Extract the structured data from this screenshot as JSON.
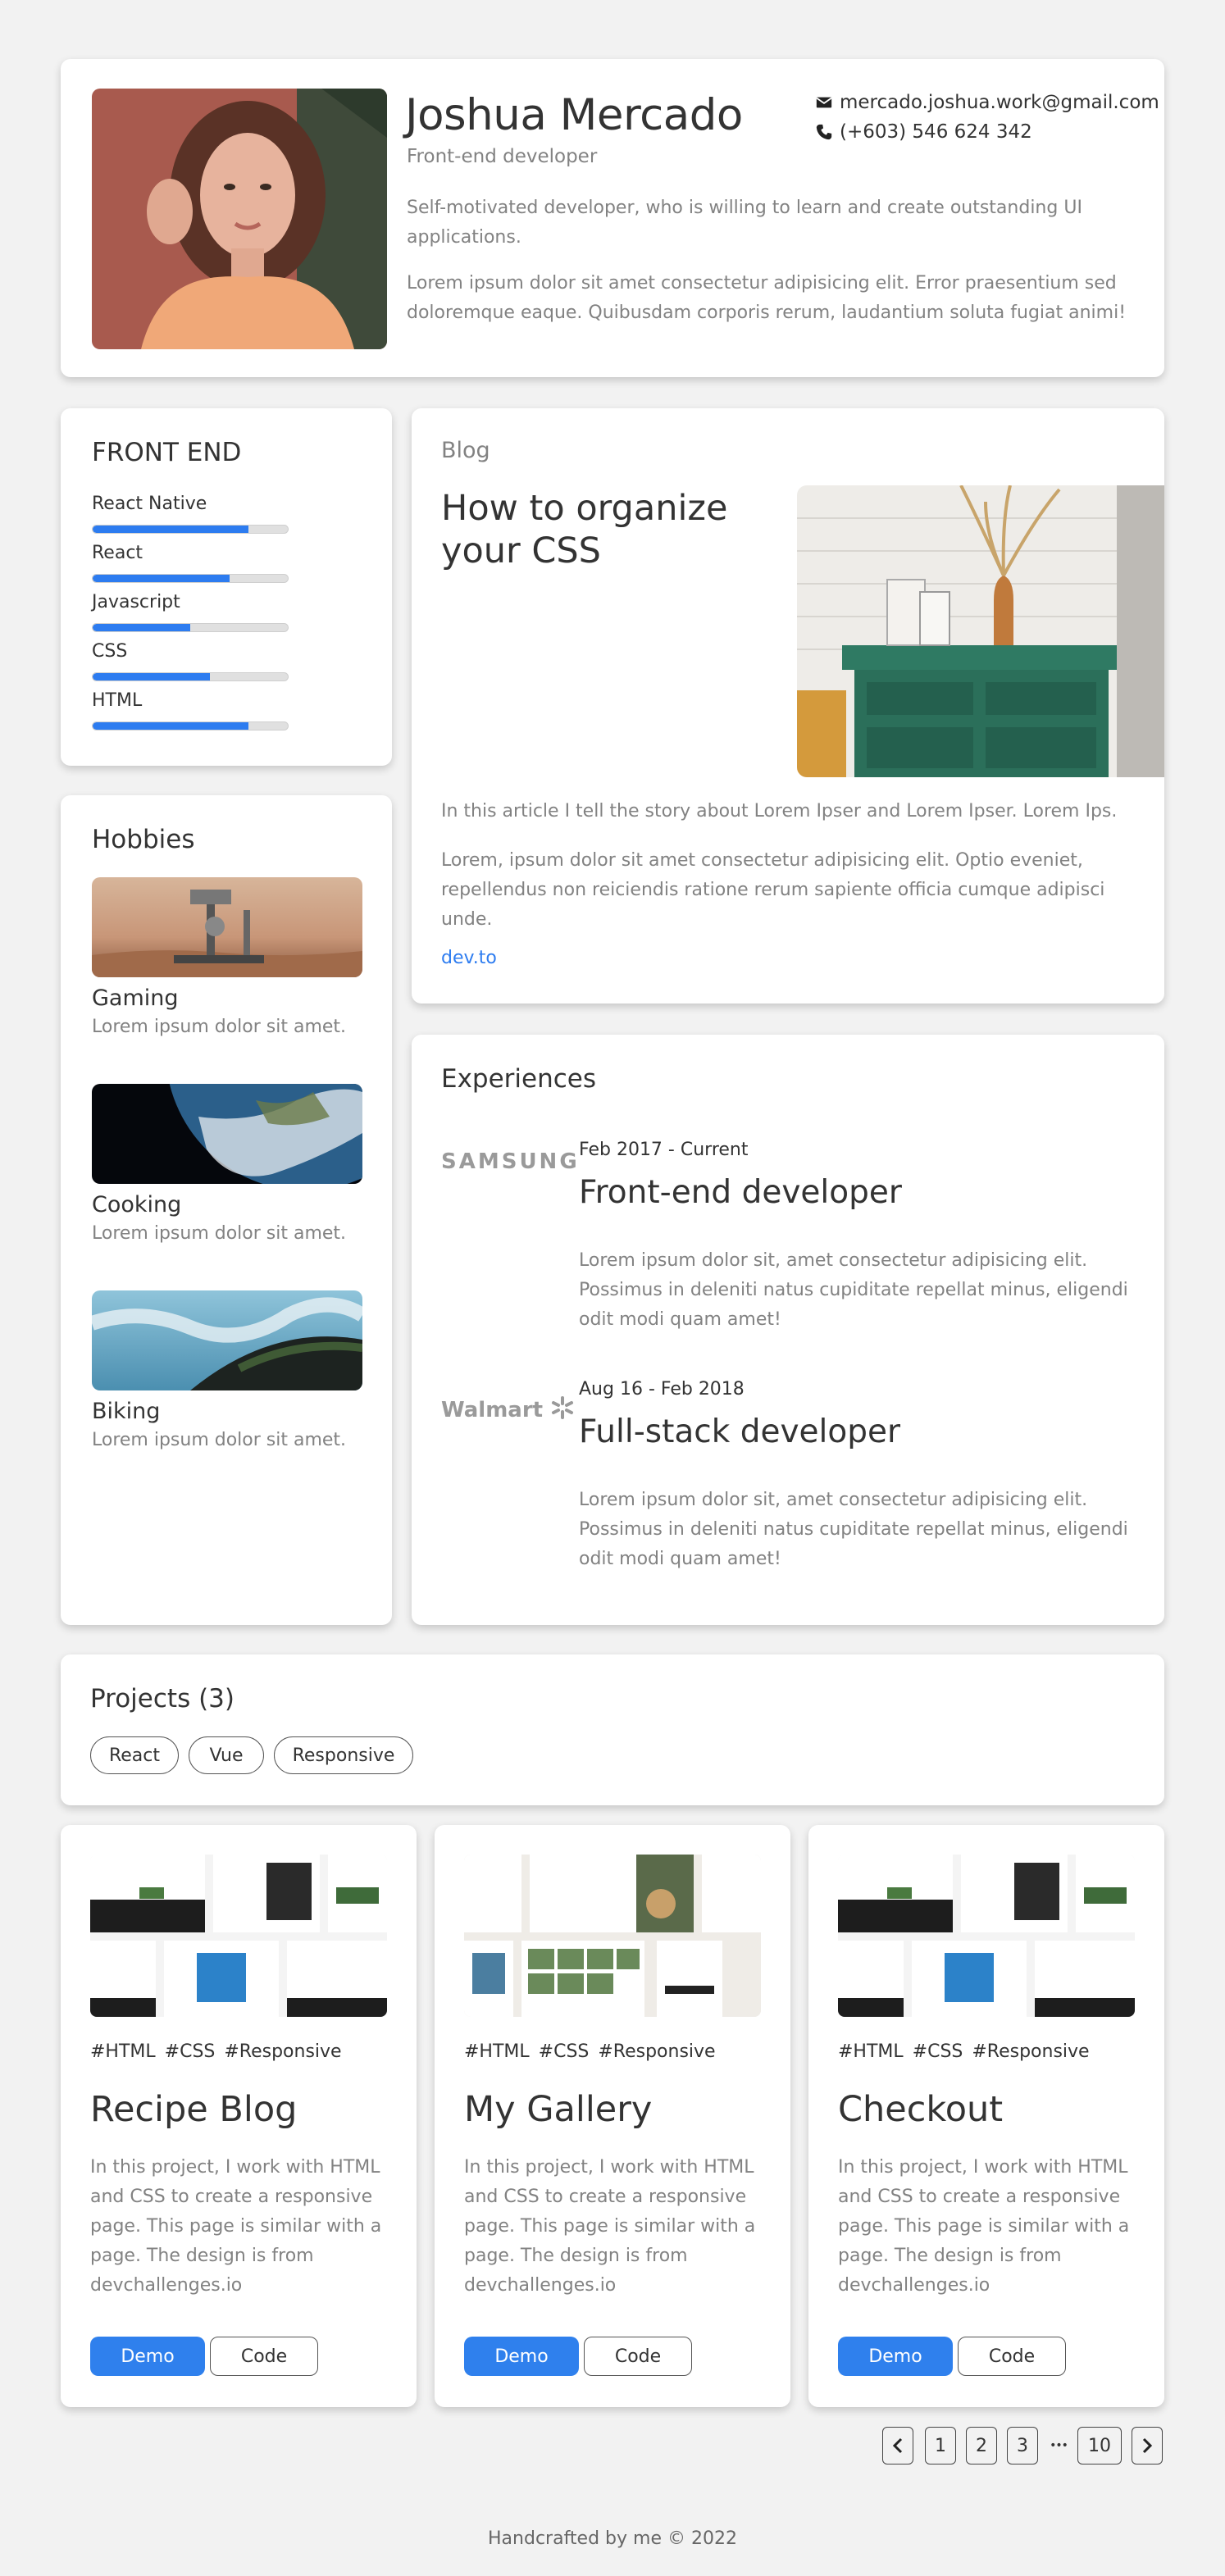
{
  "profile": {
    "name": "Joshua Mercado",
    "role": "Front-end developer",
    "email": "mercado.joshua.work@gmail.com",
    "phone": "(+603) 546 624 342",
    "bio": "Self-motivated developer, who is willing to learn and create outstanding UI applications.",
    "extra": "Lorem ipsum dolor sit amet consectetur adipisicing elit. Error praesentium sed doloremque eaque. Quibusdam corporis rerum, laudantium soluta fugiat animi!"
  },
  "skills": {
    "title": "FRONT END",
    "items": [
      {
        "label": "React Native",
        "level": 0.8
      },
      {
        "label": "React",
        "level": 0.7
      },
      {
        "label": "Javascript",
        "level": 0.5
      },
      {
        "label": "CSS",
        "level": 0.6
      },
      {
        "label": "HTML",
        "level": 0.8
      }
    ]
  },
  "hobbies": {
    "title": "Hobbies",
    "items": [
      {
        "name": "Gaming",
        "desc": "Lorem ipsum dolor sit amet."
      },
      {
        "name": "Cooking",
        "desc": "Lorem ipsum dolor sit amet."
      },
      {
        "name": "Biking",
        "desc": "Lorem ipsum dolor sit amet."
      }
    ]
  },
  "blog": {
    "kicker": "Blog",
    "title": "How to organize your CSS",
    "summary": "In this article I tell the story about Lorem Ipser and Lorem Ipser. Lorem Ips.",
    "body": "Lorem, ipsum dolor sit amet consectetur adipisicing elit. Optio eveniet, repellendus non reiciendis ratione rerum sapiente officia cumque adipisci unde.",
    "link": "dev.to"
  },
  "experiences": {
    "title": "Experiences",
    "items": [
      {
        "company": "SAMSUNG",
        "date": "Feb 2017 - Current",
        "title": "Front-end developer",
        "desc": "Lorem ipsum dolor sit, amet consectetur adipisicing elit. Possimus in deleniti natus cupiditate repellat minus, eligendi odit modi quam amet!"
      },
      {
        "company": "Walmart",
        "date": "Aug 16 - Feb 2018",
        "title": "Full-stack developer",
        "desc": "Lorem ipsum dolor sit, amet consectetur adipisicing elit. Possimus in deleniti natus cupiditate repellat minus, eligendi odit modi quam amet!"
      }
    ]
  },
  "projects": {
    "title": "Projects (3)",
    "filters": [
      "React",
      "Vue",
      "Responsive"
    ],
    "items": [
      {
        "tags": "#HTML #CSS #Responsive",
        "title": "Recipe Blog",
        "desc": "In this project, I work with HTML and CSS to create a responsive page. This page is similar with a page. The design is from devchallenges.io",
        "demo": "Demo",
        "code": "Code"
      },
      {
        "tags": "#HTML #CSS #Responsive",
        "title": "My Gallery",
        "desc": "In this project, I work with HTML and CSS to create a responsive page. This page is similar with a page. The design is from devchallenges.io",
        "demo": "Demo",
        "code": "Code"
      },
      {
        "tags": "#HTML #CSS #Responsive",
        "title": "Checkout",
        "desc": "In this project, I work with HTML and CSS to create a responsive page. This page is similar with a page. The design is from devchallenges.io",
        "demo": "Demo",
        "code": "Code"
      }
    ]
  },
  "pagination": {
    "pages": [
      "1",
      "2",
      "3"
    ],
    "ellipsis": "•••",
    "last": "10"
  },
  "footer": "Handcrafted by me © 2022",
  "colors": {
    "accent": "#2f80ed",
    "muted": "#828282",
    "background": "#f2f2f2"
  }
}
